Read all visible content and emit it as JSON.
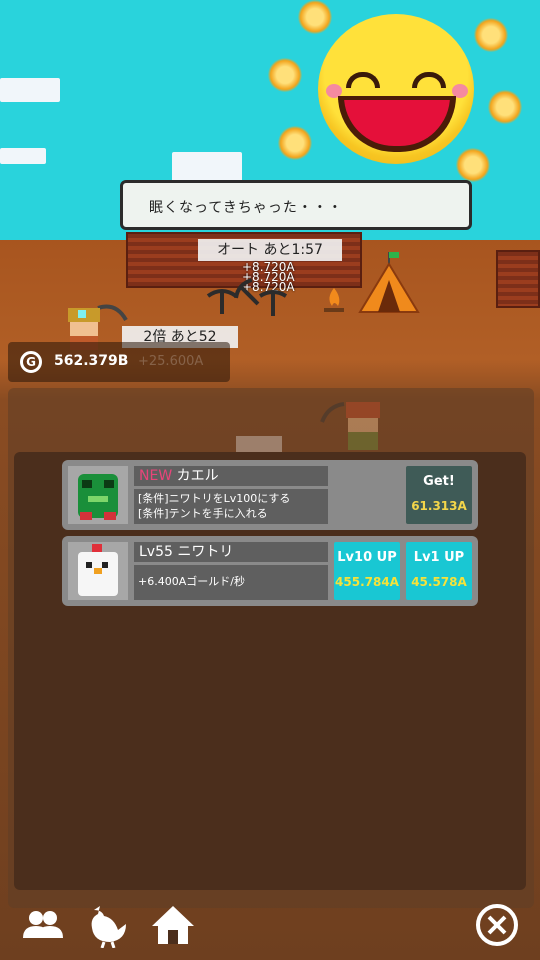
{
  "speech": {
    "text": "眠くなってきちゃった・・・"
  },
  "auto_timer": {
    "label": "オート あと1:57"
  },
  "floating_gains": [
    "+8.720A",
    "+8.720A",
    "+8.720A"
  ],
  "boost_timer": {
    "label": "2倍 あと52"
  },
  "currency": {
    "icon_text": "G",
    "value": "562.379B",
    "rate": "+25.600A"
  },
  "pets": [
    {
      "badge": "NEW",
      "name": "カエル",
      "desc_lines": [
        "[条件]ニワトリをLv100にする",
        "[条件]テントを手に入れる"
      ],
      "icon": "frog-icon",
      "get_button": {
        "label": "Get!",
        "cost": "61.313A"
      }
    },
    {
      "name": "Lv55 ニワトリ",
      "desc_lines": [
        "+6.400Aゴールド/秒"
      ],
      "icon": "chicken-icon",
      "lv10_button": {
        "label": "Lv10 UP",
        "cost": "455.784A"
      },
      "lv1_button": {
        "label": "Lv1 UP",
        "cost": "45.578A"
      }
    }
  ],
  "nav": [
    "people-icon",
    "chicken-nav-icon",
    "home-icon",
    "close-icon"
  ],
  "colors": {
    "sky": "#29d3dc",
    "badge_new": "#e8457a",
    "cost_yellow": "#f5e23a",
    "button_cyan": "#19c7d3",
    "button_gray": "#3f5b57"
  }
}
